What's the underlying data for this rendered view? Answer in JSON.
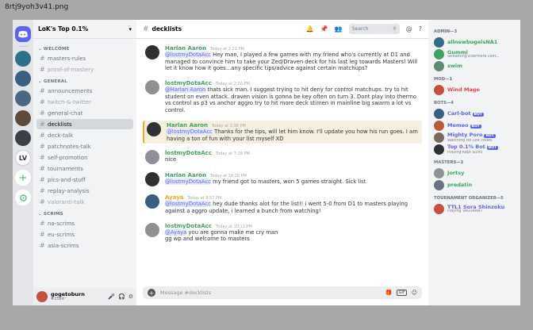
{
  "file_name": "8rtj9yoh3v41.png",
  "server": {
    "name": "LoK's Top 0.1%",
    "rail": [
      "home",
      "s1",
      "s2",
      "s3",
      "s4",
      "s5",
      "LV",
      "+",
      "explore"
    ]
  },
  "channels": {
    "categories": [
      {
        "name": "WELCOME",
        "items": [
          {
            "name": "masters-rules",
            "state": "normal"
          },
          {
            "name": "proof-of-mastery",
            "state": "dim"
          }
        ]
      },
      {
        "name": "GENERAL",
        "items": [
          {
            "name": "announcements",
            "state": "normal"
          },
          {
            "name": "twitch-&-twitter",
            "state": "dim"
          },
          {
            "name": "general-chat",
            "state": "normal"
          },
          {
            "name": "decklists",
            "state": "active"
          },
          {
            "name": "deck-talk",
            "state": "normal"
          },
          {
            "name": "patchnotes-talk",
            "state": "normal"
          },
          {
            "name": "self-promotion",
            "state": "normal"
          },
          {
            "name": "tournaments",
            "state": "normal"
          },
          {
            "name": "pics-and-stuff",
            "state": "normal"
          },
          {
            "name": "replay-analysis",
            "state": "normal"
          },
          {
            "name": "valoranti-talk",
            "state": "dim"
          }
        ]
      },
      {
        "name": "SCRIMS",
        "items": [
          {
            "name": "na-scrims",
            "state": "normal"
          },
          {
            "name": "eu-scrims",
            "state": "normal"
          },
          {
            "name": "asia-scrims",
            "state": "normal"
          }
        ]
      }
    ]
  },
  "user": {
    "name": "gogetoburn",
    "tag": "#2584",
    "color": "#c84f3c"
  },
  "topbar": {
    "channel": "decklists",
    "search_placeholder": "Search"
  },
  "messages": [
    {
      "author": "Harlan Aaron",
      "color": "#3ba55c",
      "time": "Today at 2:22 PM",
      "avatar": "#2f3136",
      "hl": false,
      "text": "@lostmyDotaAcc Hey man, I played a few games with my friend who's currently at D1 and managed to convince him to take your Zed/Draven deck for his last leg towards Masters! Will let it know how it goes...any specific tips/advice against certain matchups?"
    },
    {
      "author": "lostmyDotaAcc",
      "color": "#3ba55c",
      "time": "Today at 2:26 PM",
      "avatar": "#8e9297",
      "hl": false,
      "text": "@Harlan Aaron thats sick man. I suggest trying to hit deny for control matchups. try to hit student on even attack. draven vision is gonna be key often on turn 3. Dont play into thermo vs control as p3 vs anchor aggro try to hit more deck stimen in mainline big swarm a lot vs control."
    },
    {
      "author": "Harlan Aaron",
      "color": "#3ba55c",
      "time": "Today at 2:38 PM",
      "avatar": "#2f3136",
      "hl": true,
      "text": "@lostmyDotaAcc Thanks for the tips, will let him know. I'll update you how his run goes. I am having a ton of fun with your list myself XD"
    },
    {
      "author": "lostmyDotaAcc",
      "color": "#3ba55c",
      "time": "Today at 7:28 PM",
      "avatar": "#8e9297",
      "hl": false,
      "text": "nice"
    },
    {
      "author": "Harlan Aaron",
      "color": "#3ba55c",
      "time": "Today at 10:28 PM",
      "avatar": "#2f3136",
      "hl": false,
      "text": "@lostmyDotaAcc my friend got to masters, won 5 games straight. Sick list"
    },
    {
      "author": "Ayaya",
      "color": "#faa61a",
      "time": "Today at 9:57 PM",
      "avatar": "#3b5f80",
      "hl": false,
      "text": "@lostmyDotaAcc hey dude thanks alot for the list!! i went 5-0 from D1 to masters playing against a aggro update, i learned a bunch from watching!"
    },
    {
      "author": "lostmyDotaAcc",
      "color": "#3ba55c",
      "time": "Today at 10:11 PM",
      "avatar": "#8e9297",
      "hl": false,
      "text": "@Ayaya you are gonna make me cry man\ngg wp and welcome to masters"
    }
  ],
  "composer": {
    "placeholder": "Message #decklists",
    "icons": [
      "gift",
      "gif",
      "emoji"
    ]
  },
  "members": {
    "groups": [
      {
        "name": "ADMIN—3",
        "items": [
          {
            "name": "allnewbugeisNA1",
            "status": "",
            "color": "#3ba55c",
            "avatar": "#2f6f8a"
          },
          {
            "name": "Gummi",
            "status": "Streaming Evermore cont...",
            "color": "#3ba55c",
            "avatar": "#3ba55c"
          },
          {
            "name": "swim",
            "status": "",
            "color": "#3ba55c",
            "avatar": "#5d8a72"
          }
        ]
      },
      {
        "name": "MOD—1",
        "items": [
          {
            "name": "Wind Mage",
            "status": "",
            "color": "#ed4245",
            "avatar": "#c84f3c"
          }
        ]
      },
      {
        "name": "BOTS—4",
        "items": [
          {
            "name": "Carl-bot",
            "status": "",
            "color": "#5865f2",
            "avatar": "#3b5f80",
            "bot": true
          },
          {
            "name": "Memeo",
            "status": "",
            "color": "#5865f2",
            "avatar": "#b85c3c",
            "bot": true
          },
          {
            "name": "Mighty Poro",
            "status": "Watching for LoR codes",
            "color": "#5865f2",
            "avatar": "#7a6a5c",
            "bot": true
          },
          {
            "name": "Top 0.1% Bot",
            "status": "Playing Kept Sushi",
            "color": "#5865f2",
            "avatar": "#2f3136",
            "bot": true
          }
        ]
      },
      {
        "name": "MASTERS—2",
        "items": [
          {
            "name": "Jortsy",
            "status": "",
            "color": "#3ba55c",
            "avatar": "#8e9297"
          },
          {
            "name": "predatin",
            "status": "",
            "color": "#3ba55c",
            "avatar": "#6a7480"
          }
        ]
      },
      {
        "name": "TOURNAMENT ORGANIZER—5",
        "items": [
          {
            "name": "TTL1 Sora Shinzoku",
            "status": "Playing VALORANT",
            "color": "#5865f2",
            "avatar": "#c84f3c"
          }
        ]
      }
    ]
  },
  "icons": {
    "bell": "bell-icon",
    "pin": "pin-icon",
    "members": "members-icon",
    "inbox": "inbox-icon",
    "help": "help-icon",
    "mic": "mic-icon",
    "headphones": "headphones-icon",
    "settings": "gear-icon"
  }
}
